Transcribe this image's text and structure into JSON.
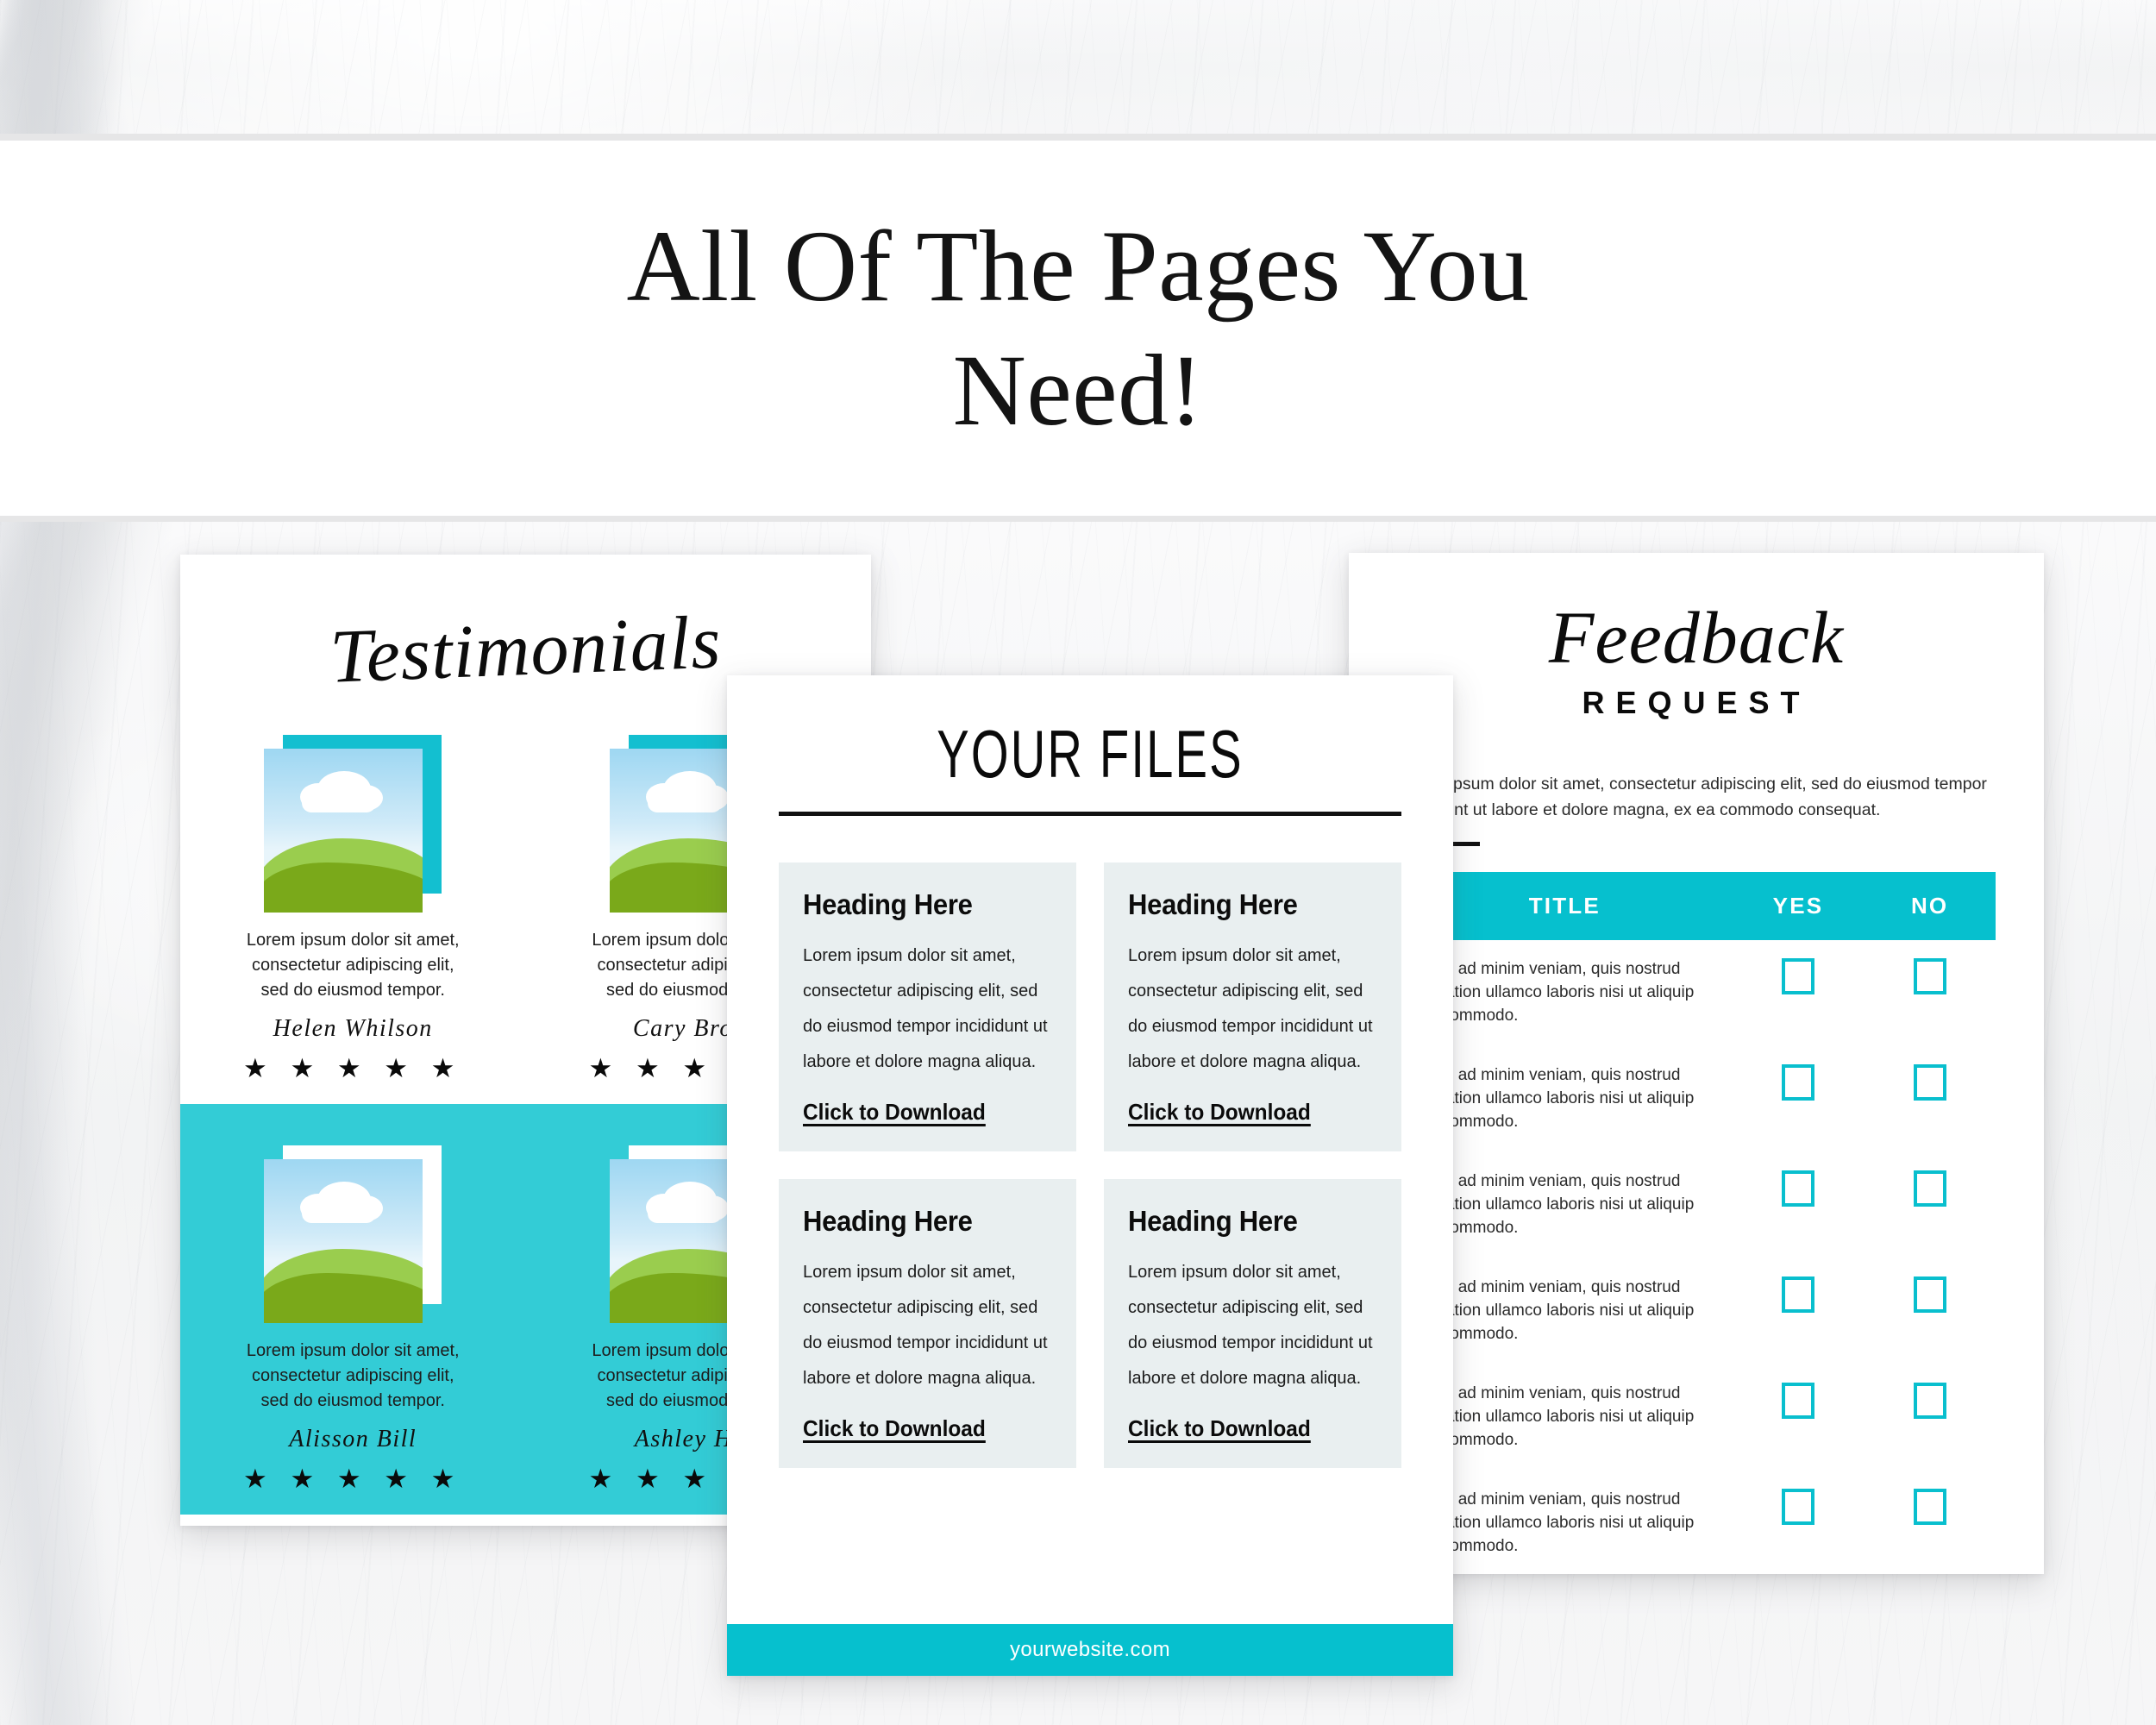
{
  "header": {
    "title_line1": "All Of The Pages You",
    "title_line2": "Need!"
  },
  "testimonials_page": {
    "title": "Testimonials",
    "items": [
      {
        "quote": "Lorem ipsum dolor sit amet, consectetur adipiscing elit, sed do eiusmod tempor.",
        "name": "Helen Whilson",
        "stars": "★ ★ ★ ★ ★"
      },
      {
        "quote": "Lorem ipsum dolor sit amet, consectetur adipiscing elit, sed do eiusmod tempor.",
        "name": "Cary Brown",
        "stars": "★ ★ ★ ★ ★"
      },
      {
        "quote": "Lorem ipsum dolor sit amet, consectetur adipiscing elit, sed do eiusmod tempor.",
        "name": "Alisson Bill",
        "stars": "★ ★ ★ ★ ★"
      },
      {
        "quote": "Lorem ipsum dolor sit amet, consectetur adipiscing elit, sed do eiusmod tempor.",
        "name": "Ashley Holt",
        "stars": "★ ★ ★ ★ ★"
      }
    ]
  },
  "files_page": {
    "title": "YOUR FILES",
    "cards": [
      {
        "heading": "Heading Here",
        "body": "Lorem ipsum dolor sit amet, consectetur adipiscing elit, sed do eiusmod tempor incididunt ut labore et dolore magna aliqua.",
        "link": "Click to Download"
      },
      {
        "heading": "Heading Here",
        "body": "Lorem ipsum dolor sit amet, consectetur adipiscing elit, sed do eiusmod tempor incididunt ut labore et dolore magna aliqua.",
        "link": "Click to Download"
      },
      {
        "heading": "Heading Here",
        "body": "Lorem ipsum dolor sit amet, consectetur adipiscing elit, sed do eiusmod tempor incididunt ut labore et dolore magna aliqua.",
        "link": "Click to Download"
      },
      {
        "heading": "Heading Here",
        "body": "Lorem ipsum dolor sit amet, consectetur adipiscing elit, sed do eiusmod tempor incididunt ut labore et dolore magna aliqua.",
        "link": "Click to Download"
      }
    ],
    "footer_url": "yourwebsite.com"
  },
  "feedback_page": {
    "script_title": "Feedback",
    "sub_title": "REQUEST",
    "intro": "Lorem ipsum dolor sit amet, consectetur adipiscing elit, sed do eiusmod tempor incididunt ut labore et dolore magna, ex ea commodo consequat.",
    "table": {
      "headers": [
        "TITLE",
        "YES",
        "NO"
      ],
      "rows": [
        {
          "title": "Ut enim ad minim veniam, quis nostrud exercitation ullamco laboris nisi ut aliquip ex ea commodo."
        },
        {
          "title": "Ut enim ad minim veniam, quis nostrud exercitation ullamco laboris nisi ut aliquip ex ea commodo."
        },
        {
          "title": "Ut enim ad minim veniam, quis nostrud exercitation ullamco laboris nisi ut aliquip ex ea commodo."
        },
        {
          "title": "Ut enim ad minim veniam, quis nostrud exercitation ullamco laboris nisi ut aliquip ex ea commodo."
        },
        {
          "title": "Ut enim ad minim veniam, quis nostrud exercitation ullamco laboris nisi ut aliquip ex ea commodo."
        },
        {
          "title": "Ut enim ad minim veniam, quis nostrud exercitation ullamco laboris nisi ut aliquip ex ea commodo."
        }
      ]
    }
  },
  "colors": {
    "teal_dark": "#06C0CE",
    "teal_light": "#33CCD6",
    "card_bg": "#E9EFF0",
    "hill_light": "#9ACD4E",
    "hill_dark": "#7AA91A"
  }
}
